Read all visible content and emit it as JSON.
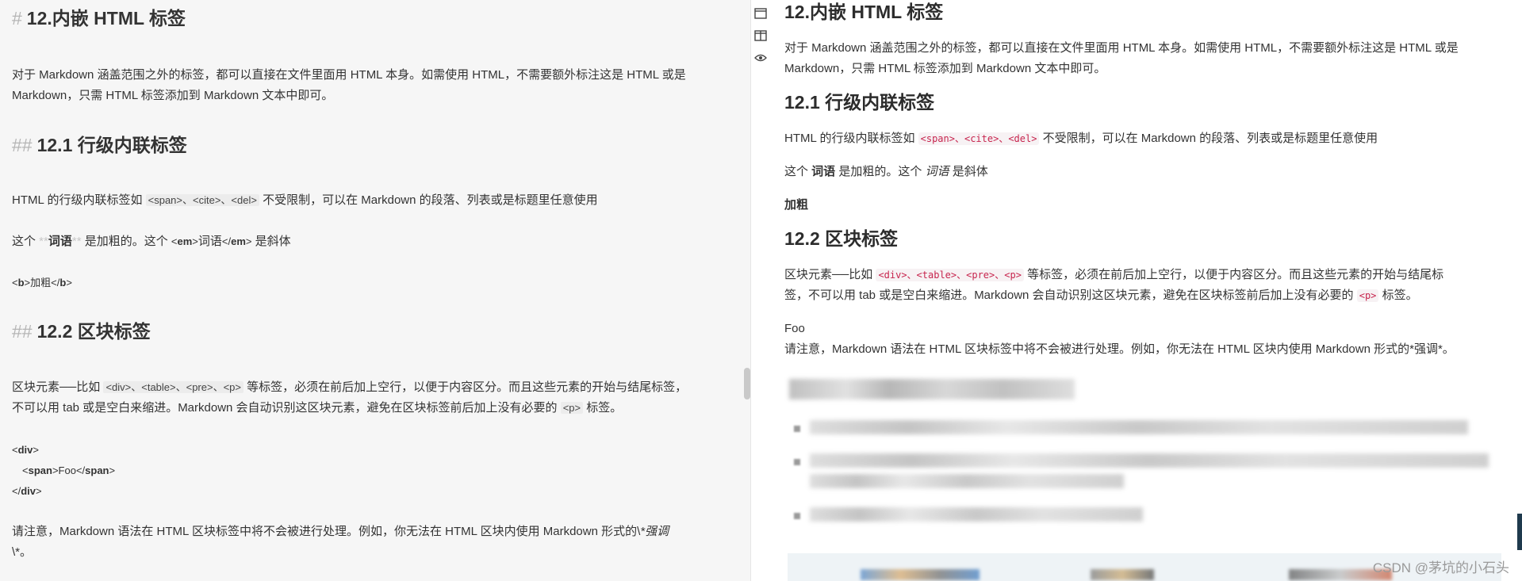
{
  "editor": {
    "h12": {
      "mark": "#",
      "text": "12.内嵌 HTML 标签"
    },
    "intro_line1": "对于 Markdown 涵盖范围之外的标签，都可以直接在文件里面用 HTML 本身。如需使用 HTML，不需要额外标注这是 HTML 或是",
    "intro_line2": "Markdown，只需 HTML 标签添加到 Markdown 文本中即可。",
    "h121": {
      "mark": "##",
      "text": "12.1 行级内联标签"
    },
    "inline_pre": "HTML 的行级内联标签如 ",
    "inline_code": "<span>、<cite>、<del>",
    "inline_post": " 不受限制，可以在 Markdown 的段落、列表或是标题里任意使用",
    "bold_line": {
      "pre": "这个 ",
      "mark_open": "**",
      "word": "词语",
      "mark_close": "**",
      "mid": " 是加粗的。这个 ",
      "em_open": "<em>",
      "em_word": "词语",
      "em_close": "</em>",
      "post": " 是斜体"
    },
    "b_line": {
      "open": "<b>",
      "word": "加粗",
      "close": "</b>"
    },
    "h122": {
      "mark": "##",
      "text": "12.2 区块标签"
    },
    "block_line1_pre": "区块元素──比如 ",
    "block_line1_code": "<div>、<table>、<pre>、<p>",
    "block_line1_post": " 等标签，必须在前后加上空行，以便于内容区分。而且这些元素的开始与结尾标签，",
    "block_line2_pre": "不可以用 tab 或是空白来缩进。Markdown 会自动识别这区块元素，避免在区块标签前后加上没有必要的 ",
    "block_line2_code": "<p>",
    "block_line2_post": " 标签。",
    "div_open": "<div>",
    "span_line": {
      "open": "<span>",
      "word": "Foo",
      "close": "</span>"
    },
    "div_close": "</div>",
    "note_line1_pre": "请注意，Markdown 语法在 HTML 区块标签中将不会被进行处理。例如，你无法在 HTML 区块内使用 Markdown 形式的\\",
    "note_line1_em": "*强调",
    "note_line2": "\\*。"
  },
  "toolbar": {
    "icons": [
      "window-icon",
      "split-view-icon",
      "preview-eye-icon"
    ]
  },
  "preview": {
    "h12": "12.内嵌 HTML 标签",
    "intro_line1": "对于 Markdown 涵盖范围之外的标签，都可以直接在文件里面用 HTML 本身。如需使用 HTML，不需要额外标注这是 HTML 或是",
    "intro_line2": "Markdown，只需 HTML 标签添加到 Markdown 文本中即可。",
    "h121": "12.1 行级内联标签",
    "inline_pre": "HTML 的行级内联标签如 ",
    "inline_code": "<span>、<cite>、<del>",
    "inline_post": " 不受限制，可以在 Markdown 的段落、列表或是标题里任意使用",
    "bold_pre": "这个 ",
    "bold_word": "词语",
    "bold_mid": " 是加粗的。这个 ",
    "italic_word": "词语",
    "bold_post": " 是斜体",
    "b_text": "加粗",
    "h122": "12.2 区块标签",
    "block_line1_pre": "区块元素──比如 ",
    "block_line1_code": "<div>、<table>、<pre>、<p>",
    "block_line1_post": " 等标签，必须在前后加上空行，以便于内容区分。而且这些元素的开始与结尾标",
    "block_line2_pre": "签，不可以用 tab 或是空白来缩进。Markdown 会自动识别这区块元素，避免在区块标签前后加上没有必要的 ",
    "block_line2_code": "<p>",
    "block_line2_post": " 标签。",
    "foo": "Foo",
    "note": "请注意，Markdown 语法在 HTML 区块标签中将不会被进行处理。例如，你无法在 HTML 区块内使用 Markdown 形式的*强调*。"
  },
  "watermark": "CSDN @茅坑的小石头"
}
